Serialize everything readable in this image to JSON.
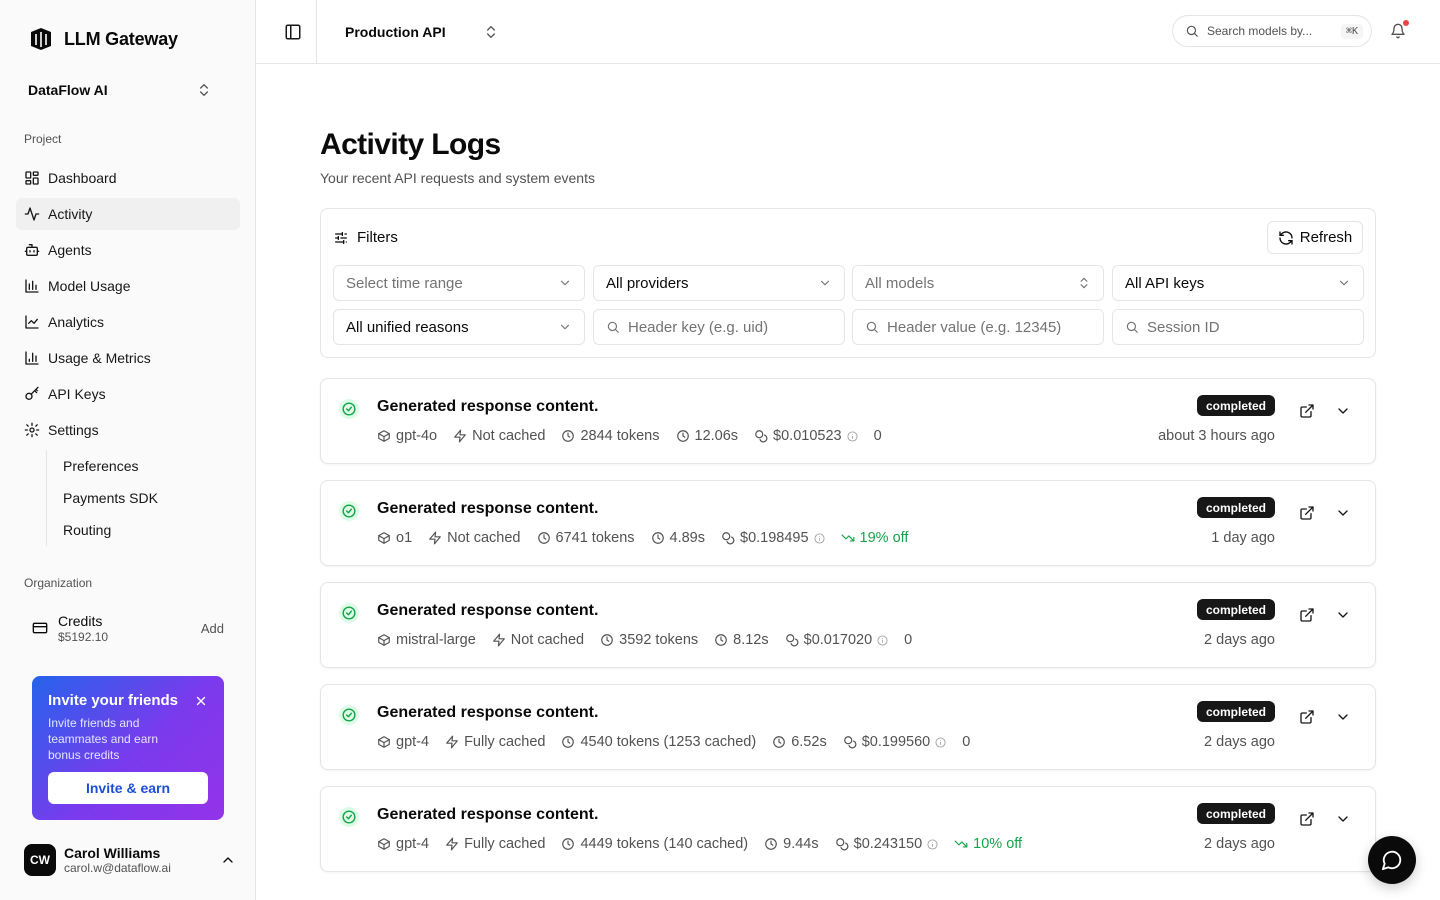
{
  "brand": {
    "name": "LLM Gateway"
  },
  "org": {
    "name": "DataFlow AI"
  },
  "sidebar": {
    "project_label": "Project",
    "items": [
      {
        "label": "Dashboard",
        "icon": "dashboard-icon"
      },
      {
        "label": "Activity",
        "icon": "activity-icon",
        "active": true
      },
      {
        "label": "Agents",
        "icon": "bot-icon"
      },
      {
        "label": "Model Usage",
        "icon": "bar-chart-icon"
      },
      {
        "label": "Analytics",
        "icon": "line-chart-icon"
      },
      {
        "label": "Usage & Metrics",
        "icon": "column-chart-icon"
      },
      {
        "label": "API Keys",
        "icon": "key-icon"
      },
      {
        "label": "Settings",
        "icon": "gear-icon"
      }
    ],
    "settings_sub": [
      "Preferences",
      "Payments SDK",
      "Routing"
    ],
    "org_label": "Organization",
    "credits": {
      "title": "Credits",
      "amount": "$5192.10",
      "add": "Add"
    },
    "invite": {
      "title": "Invite your friends",
      "description": "Invite friends and teammates and earn bonus credits",
      "button": "Invite & earn"
    },
    "user": {
      "initials": "CW",
      "name": "Carol Williams",
      "email": "carol.w@dataflow.ai"
    }
  },
  "topbar": {
    "project": "Production API",
    "search_placeholder": "Search models by...",
    "search_shortcut": "⌘K"
  },
  "page": {
    "title": "Activity Logs",
    "subtitle": "Your recent API requests and system events"
  },
  "filters": {
    "label": "Filters",
    "refresh": "Refresh",
    "time_range": "Select time range",
    "providers": "All providers",
    "models": "All models",
    "api_keys": "All API keys",
    "reasons": "All unified reasons",
    "header_key_placeholder": "Header key (e.g. uid)",
    "header_value_placeholder": "Header value (e.g. 12345)",
    "session_placeholder": "Session ID"
  },
  "logs": [
    {
      "title": "Generated response content.",
      "model": "gpt-4o",
      "cache": "Not cached",
      "tokens": "2844 tokens",
      "duration": "12.06s",
      "cost": "$0.010523",
      "extra": "0",
      "discount": false,
      "status": "completed",
      "ago": "about 3 hours ago"
    },
    {
      "title": "Generated response content.",
      "model": "o1",
      "cache": "Not cached",
      "tokens": "6741 tokens",
      "duration": "4.89s",
      "cost": "$0.198495",
      "extra": "19% off",
      "discount": true,
      "status": "completed",
      "ago": "1 day ago"
    },
    {
      "title": "Generated response content.",
      "model": "mistral-large",
      "cache": "Not cached",
      "tokens": "3592 tokens",
      "duration": "8.12s",
      "cost": "$0.017020",
      "extra": "0",
      "discount": false,
      "status": "completed",
      "ago": "2 days ago"
    },
    {
      "title": "Generated response content.",
      "model": "gpt-4",
      "cache": "Fully cached",
      "tokens": "4540 tokens (1253 cached)",
      "duration": "6.52s",
      "cost": "$0.199560",
      "extra": "0",
      "discount": false,
      "status": "completed",
      "ago": "2 days ago"
    },
    {
      "title": "Generated response content.",
      "model": "gpt-4",
      "cache": "Fully cached",
      "tokens": "4449 tokens (140 cached)",
      "duration": "9.44s",
      "cost": "$0.243150",
      "extra": "10% off",
      "discount": true,
      "status": "completed",
      "ago": "2 days ago"
    }
  ]
}
